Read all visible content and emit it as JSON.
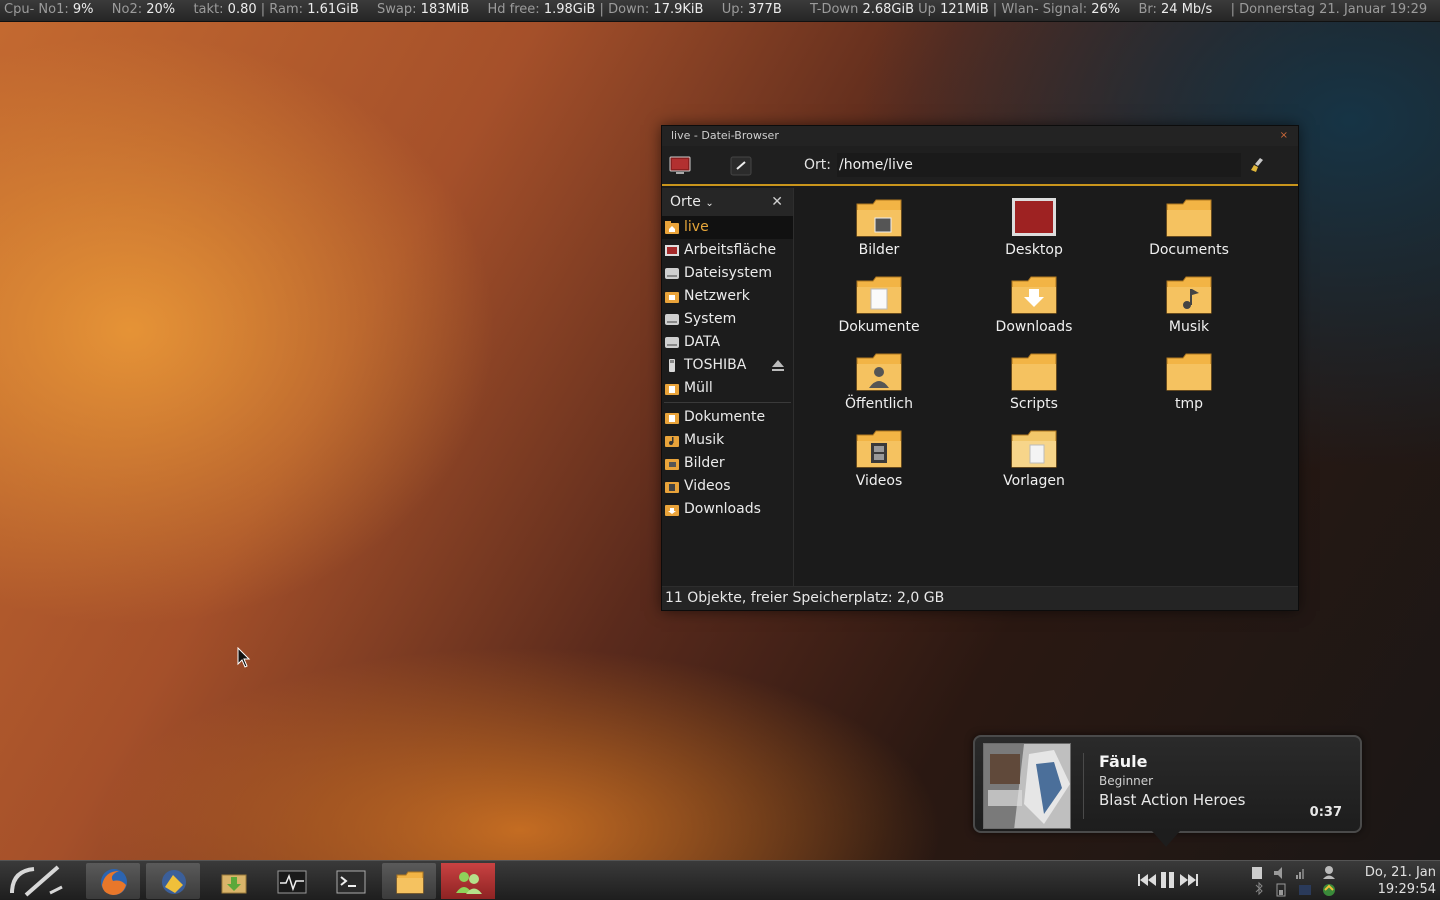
{
  "topbar": {
    "cpu_label": "Cpu- No1:",
    "cpu_value": "9%",
    "no2_label": "No2:",
    "no2_value": "20%",
    "takt_label": "takt:",
    "takt_value": "0.80",
    "sep": "|",
    "ram_label": "Ram:",
    "ram_value": "1.61GiB",
    "swap_label": "Swap:",
    "swap_value": "183MiB",
    "hd_label": "Hd free:",
    "hd_value": "1.98GiB",
    "down_label": "Down:",
    "down_value": "17.9KiB",
    "up_label": "Up:",
    "up_value": "377B",
    "tdown_label": "T-Down",
    "tdown_value": "2.68GiB",
    "tup_label": "Up",
    "tup_value": "121MiB",
    "wlan_label": "Wlan- Signal:",
    "wlan_value": "26%",
    "br_label": "Br:",
    "br_value": "24 Mb/s",
    "date": "Donnerstag 21. Januar 19:29"
  },
  "file_browser": {
    "title": "live - Datei-Browser",
    "close": "×",
    "location_label": "Ort:",
    "location_value": "/home/live",
    "sidebar_header": "Orte",
    "sidebar_header_arrow": "⌄",
    "sidebar_close": "✕",
    "places": [
      {
        "label": "live",
        "icon": "home-folder-icon"
      },
      {
        "label": "Arbeitsfläche",
        "icon": "desktop-icon"
      },
      {
        "label": "Dateisystem",
        "icon": "drive-icon"
      },
      {
        "label": "Netzwerk",
        "icon": "network-folder-icon"
      },
      {
        "label": "System",
        "icon": "drive-icon"
      },
      {
        "label": "DATA",
        "icon": "drive-icon"
      },
      {
        "label": "TOSHIBA",
        "icon": "usb-icon"
      },
      {
        "label": "Müll",
        "icon": "trash-icon"
      }
    ],
    "bookmarks": [
      {
        "label": "Dokumente",
        "icon": "documents-folder-icon"
      },
      {
        "label": "Musik",
        "icon": "music-folder-icon"
      },
      {
        "label": "Bilder",
        "icon": "pictures-folder-icon"
      },
      {
        "label": "Videos",
        "icon": "videos-folder-icon"
      },
      {
        "label": "Downloads",
        "icon": "downloads-folder-icon"
      }
    ],
    "items": [
      {
        "label": "Bilder",
        "icon": "pictures-folder-icon"
      },
      {
        "label": "Desktop",
        "icon": "desktop-folder-icon"
      },
      {
        "label": "Documents",
        "icon": "folder-icon"
      },
      {
        "label": "Dokumente",
        "icon": "documents-folder-icon"
      },
      {
        "label": "Downloads",
        "icon": "downloads-folder-icon"
      },
      {
        "label": "Musik",
        "icon": "music-folder-icon"
      },
      {
        "label": "Öffentlich",
        "icon": "public-folder-icon"
      },
      {
        "label": "Scripts",
        "icon": "folder-icon"
      },
      {
        "label": "tmp",
        "icon": "folder-icon"
      },
      {
        "label": "Videos",
        "icon": "videos-folder-icon"
      },
      {
        "label": "Vorlagen",
        "icon": "templates-folder-icon"
      }
    ],
    "status": "11 Objekte, freier Speicherplatz: 2,0 GB"
  },
  "notification": {
    "title": "Fäule",
    "artist": "Beginner",
    "album": "Blast Action Heroes",
    "time": "0:37"
  },
  "taskbar": {
    "launchers": [
      "menu-logo-icon",
      "firefox-icon",
      "file-manager-icon",
      "package-icon",
      "system-monitor-icon",
      "terminal-icon",
      "folder-icon",
      "users-icon"
    ],
    "clock_date": "Do, 21. Jan",
    "clock_time": "19:29:54"
  },
  "colors": {
    "accent": "#c9951c",
    "active_place": "#e6a63a",
    "folder": "#f2b445"
  }
}
